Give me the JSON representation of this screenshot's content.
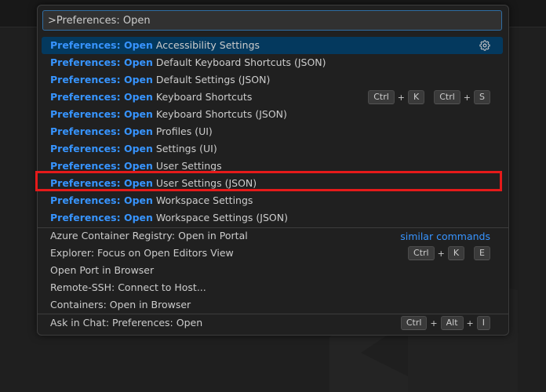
{
  "quick_open": {
    "input_value": ">Preferences: Open",
    "prefix": "Preferences: Open",
    "preference_items": [
      {
        "suffix": " Accessibility Settings"
      },
      {
        "suffix": " Default Keyboard Shortcuts (JSON)"
      },
      {
        "suffix": " Default Settings (JSON)"
      },
      {
        "suffix": " Keyboard Shortcuts"
      },
      {
        "suffix": " Keyboard Shortcuts (JSON)"
      },
      {
        "suffix": " Profiles (UI)"
      },
      {
        "suffix": " Settings (UI)"
      },
      {
        "suffix": " User Settings"
      },
      {
        "suffix": " User Settings (JSON)"
      },
      {
        "suffix": " Workspace Settings"
      },
      {
        "suffix": " Workspace Settings (JSON)"
      }
    ],
    "keyboard_shortcuts_keys": [
      "Ctrl",
      "K",
      "Ctrl",
      "S"
    ],
    "similar_commands_label": "similar commands",
    "other_items": [
      {
        "label": "Azure Container Registry: Open in Portal"
      },
      {
        "label": "Explorer: Focus on Open Editors View"
      },
      {
        "label": "Open Port in Browser"
      },
      {
        "label": "Remote-SSH: Connect to Host..."
      },
      {
        "label": "Containers: Open in Browser"
      }
    ],
    "explorer_keys": [
      "Ctrl",
      "K",
      "E"
    ],
    "chat_item": {
      "label": "Ask in Chat: Preferences: Open",
      "keys": [
        "Ctrl",
        "Alt",
        "I"
      ]
    }
  },
  "colors": {
    "accent": "#3794ff",
    "selection": "#04395e",
    "highlight_border": "#e51a1a"
  }
}
